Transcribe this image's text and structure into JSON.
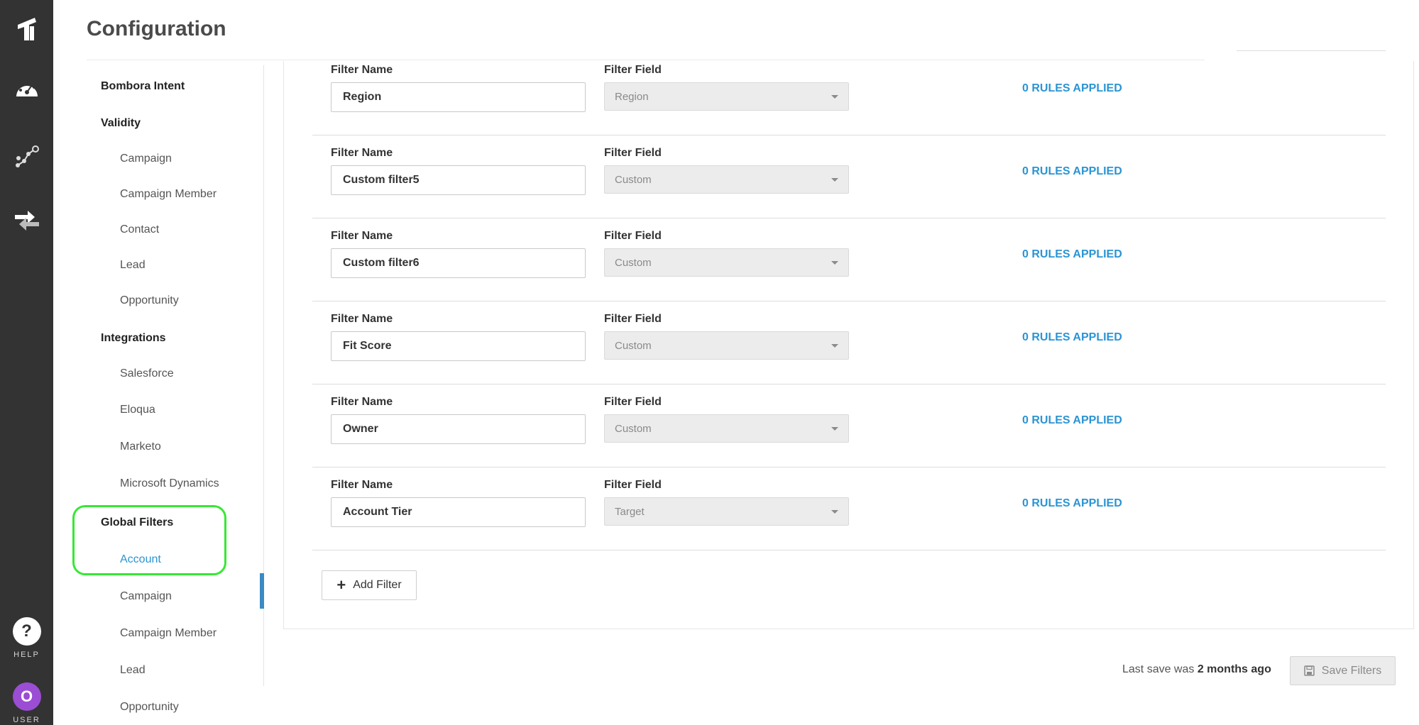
{
  "page": {
    "title": "Configuration"
  },
  "rail": {
    "help_label": "HELP",
    "help_glyph": "?",
    "user_label": "USER",
    "user_initial": "O",
    "icons": [
      "logo-icon",
      "dashboard-icon",
      "scatter-graph-icon",
      "sync-arrows-icon"
    ]
  },
  "subnav": {
    "bombora": "Bombora Intent",
    "validity": {
      "label": "Validity",
      "items": [
        "Campaign",
        "Campaign Member",
        "Contact",
        "Lead",
        "Opportunity"
      ]
    },
    "integrations": {
      "label": "Integrations",
      "items": [
        "Salesforce",
        "Eloqua",
        "Marketo",
        "Microsoft Dynamics"
      ]
    },
    "global_filters": {
      "label": "Global Filters",
      "items": [
        "Account",
        "Campaign",
        "Campaign Member",
        "Lead",
        "Opportunity"
      ],
      "active": "Account"
    }
  },
  "filters": {
    "name_label": "Filter Name",
    "field_label": "Filter Field",
    "rows": [
      {
        "name": "Region",
        "field": "Region",
        "rules": "0 RULES APPLIED"
      },
      {
        "name": "Custom filter5",
        "field": "Custom",
        "rules": "0 RULES APPLIED"
      },
      {
        "name": "Custom filter6",
        "field": "Custom",
        "rules": "0 RULES APPLIED"
      },
      {
        "name": "Fit Score",
        "field": "Custom",
        "rules": "0 RULES APPLIED"
      },
      {
        "name": "Owner",
        "field": "Custom",
        "rules": "0 RULES APPLIED"
      },
      {
        "name": "Account Tier",
        "field": "Target",
        "rules": "0 RULES APPLIED"
      }
    ],
    "add_label": "Add Filter"
  },
  "footer": {
    "last_save_prefix": "Last save was ",
    "last_save_value": "2 months ago",
    "save_label": "Save Filters"
  },
  "colors": {
    "rail": "#333333",
    "accent": "#2b94d3",
    "highlight": "#37e834",
    "user_avatar": "#9b4dd4"
  }
}
